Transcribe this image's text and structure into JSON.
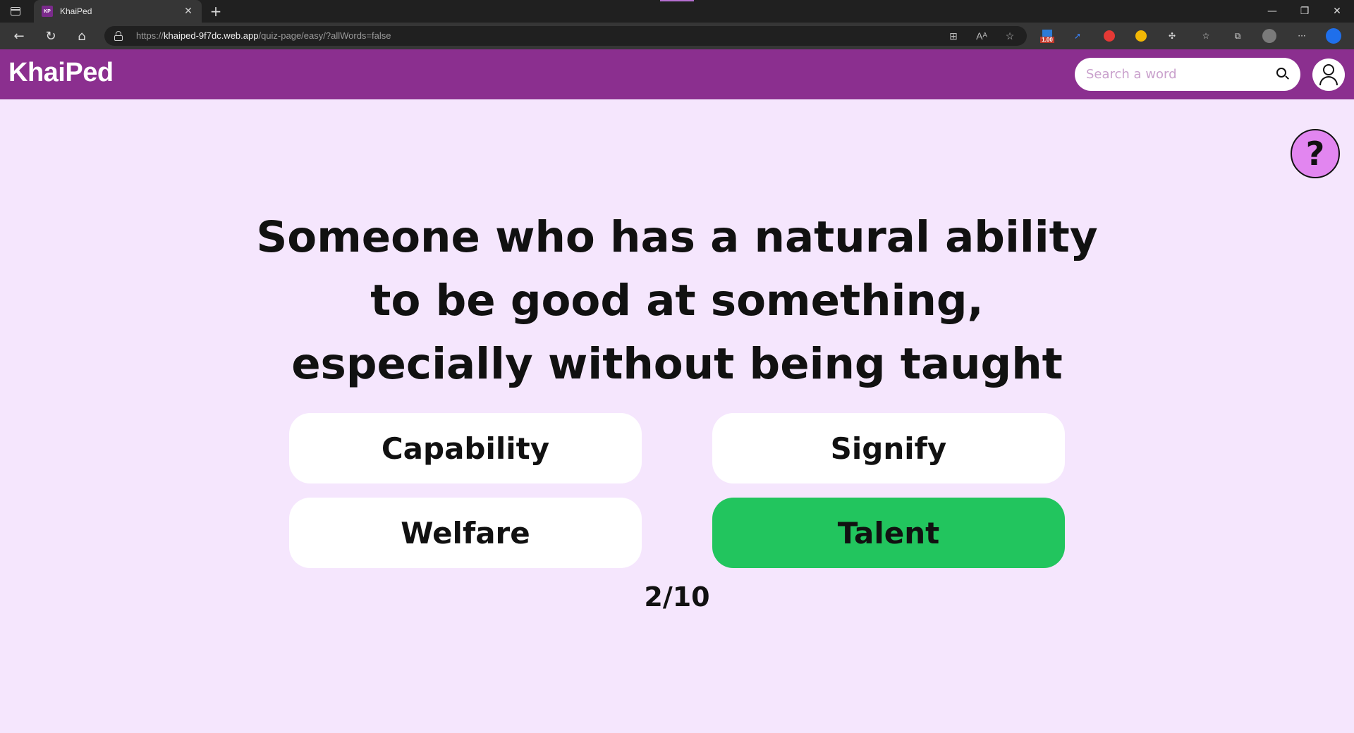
{
  "browser": {
    "tab_title": "KhaiPed",
    "tab_favicon_text": "KP",
    "url_prefix": "https://",
    "url_host": "khaiped-9f7dc.web.app",
    "url_path": "/quiz-page/easy/?allWords=false",
    "extension_badge": "1.00"
  },
  "header": {
    "logo": "KhaiPed",
    "search_placeholder": "Search a word"
  },
  "help_label": "?",
  "quiz": {
    "question": "Someone who has a natural ability to be good at something, especially without being taught",
    "answers": [
      {
        "label": "Capability",
        "state": "default"
      },
      {
        "label": "Signify",
        "state": "default"
      },
      {
        "label": "Welfare",
        "state": "default"
      },
      {
        "label": "Talent",
        "state": "correct"
      }
    ],
    "progress": "2/10"
  },
  "colors": {
    "header_bg": "#8b2f8f",
    "page_bg": "#f5e6fd",
    "correct": "#22c55e",
    "help_button": "#e286f0"
  }
}
